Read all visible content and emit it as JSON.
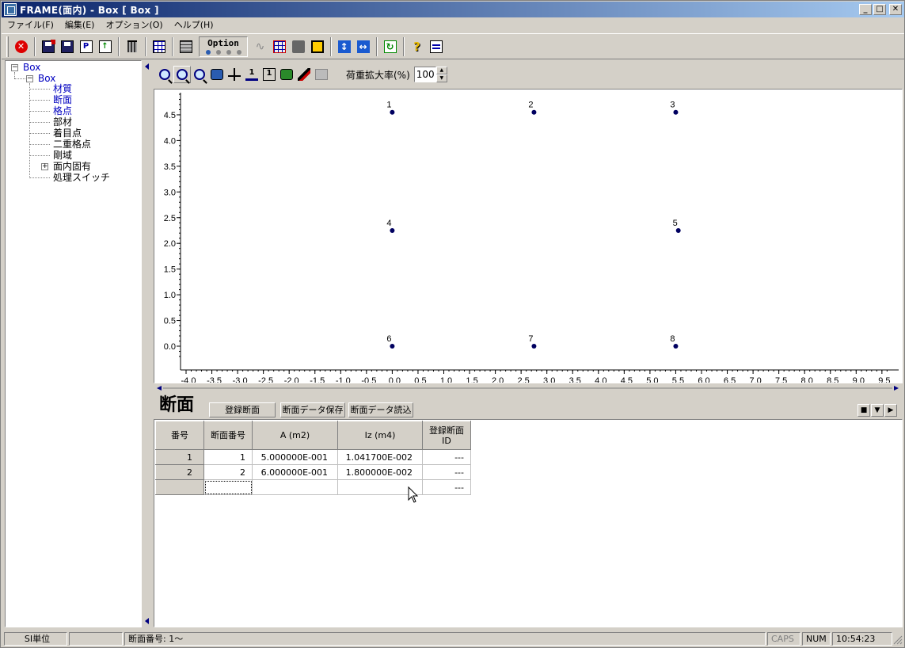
{
  "window": {
    "title": "FRAME(面内) - Box [ Box ]"
  },
  "menu": [
    "ファイル(F)",
    "編集(E)",
    "オプション(O)",
    "ヘルプ(H)"
  ],
  "toolbar": {
    "option_label": "Option"
  },
  "tree": {
    "root": "Box",
    "child": "Box",
    "items": [
      "材質",
      "断面",
      "格点",
      "部材",
      "着目点",
      "二重格点",
      "剛域",
      "面内固有",
      "処理スイッチ"
    ],
    "selected": "断面"
  },
  "viewbar": {
    "load_scale_label": "荷重拡大率(%)",
    "load_scale_value": "100"
  },
  "chart_data": {
    "type": "scatter",
    "xlim": [
      -4.0,
      9.5
    ],
    "ylim": [
      -0.2,
      4.9
    ],
    "x_ticks": [
      "-4.0",
      "-3.5",
      "-3.0",
      "-2.5",
      "-2.0",
      "-1.5",
      "-1.0",
      "-0.5",
      "0.0",
      "0.5",
      "1.0",
      "1.5",
      "2.0",
      "2.5",
      "3.0",
      "3.5",
      "4.0",
      "4.5",
      "5.0",
      "5.5",
      "6.0",
      "6.5",
      "7.0",
      "7.5",
      "8.0",
      "8.5",
      "9.0",
      "9.5"
    ],
    "y_ticks": [
      "0.0",
      "0.5",
      "1.0",
      "1.5",
      "2.0",
      "2.5",
      "3.0",
      "3.5",
      "4.0",
      "4.5"
    ],
    "points": [
      {
        "label": "1",
        "x": 0.0,
        "y": 4.55
      },
      {
        "label": "2",
        "x": 2.75,
        "y": 4.55
      },
      {
        "label": "3",
        "x": 5.5,
        "y": 4.55
      },
      {
        "label": "4",
        "x": 0.0,
        "y": 2.25
      },
      {
        "label": "5",
        "x": 5.55,
        "y": 2.25
      },
      {
        "label": "6",
        "x": 0.0,
        "y": 0.0
      },
      {
        "label": "7",
        "x": 2.75,
        "y": 0.0
      },
      {
        "label": "8",
        "x": 5.5,
        "y": 0.0
      }
    ],
    "colors": {
      "point": "#000060"
    }
  },
  "panel": {
    "title": "断面",
    "buttons": [
      "登録断面",
      "断面データ保存",
      "断面データ読込"
    ]
  },
  "grid": {
    "headers": [
      "番号",
      "断面番号",
      "A (m2)",
      "Iz (m4)",
      "登録断面\nID"
    ],
    "rows": [
      [
        "1",
        "1",
        "5.000000E-001",
        "1.041700E-002",
        "---"
      ],
      [
        "2",
        "2",
        "6.000000E-001",
        "1.800000E-002",
        "---"
      ],
      [
        "",
        "",
        "",
        "",
        "---"
      ]
    ]
  },
  "status": {
    "units": "SI単位",
    "message": "断面番号: 1〜",
    "caps": "CAPS",
    "num": "NUM",
    "time": "10:54:23"
  }
}
